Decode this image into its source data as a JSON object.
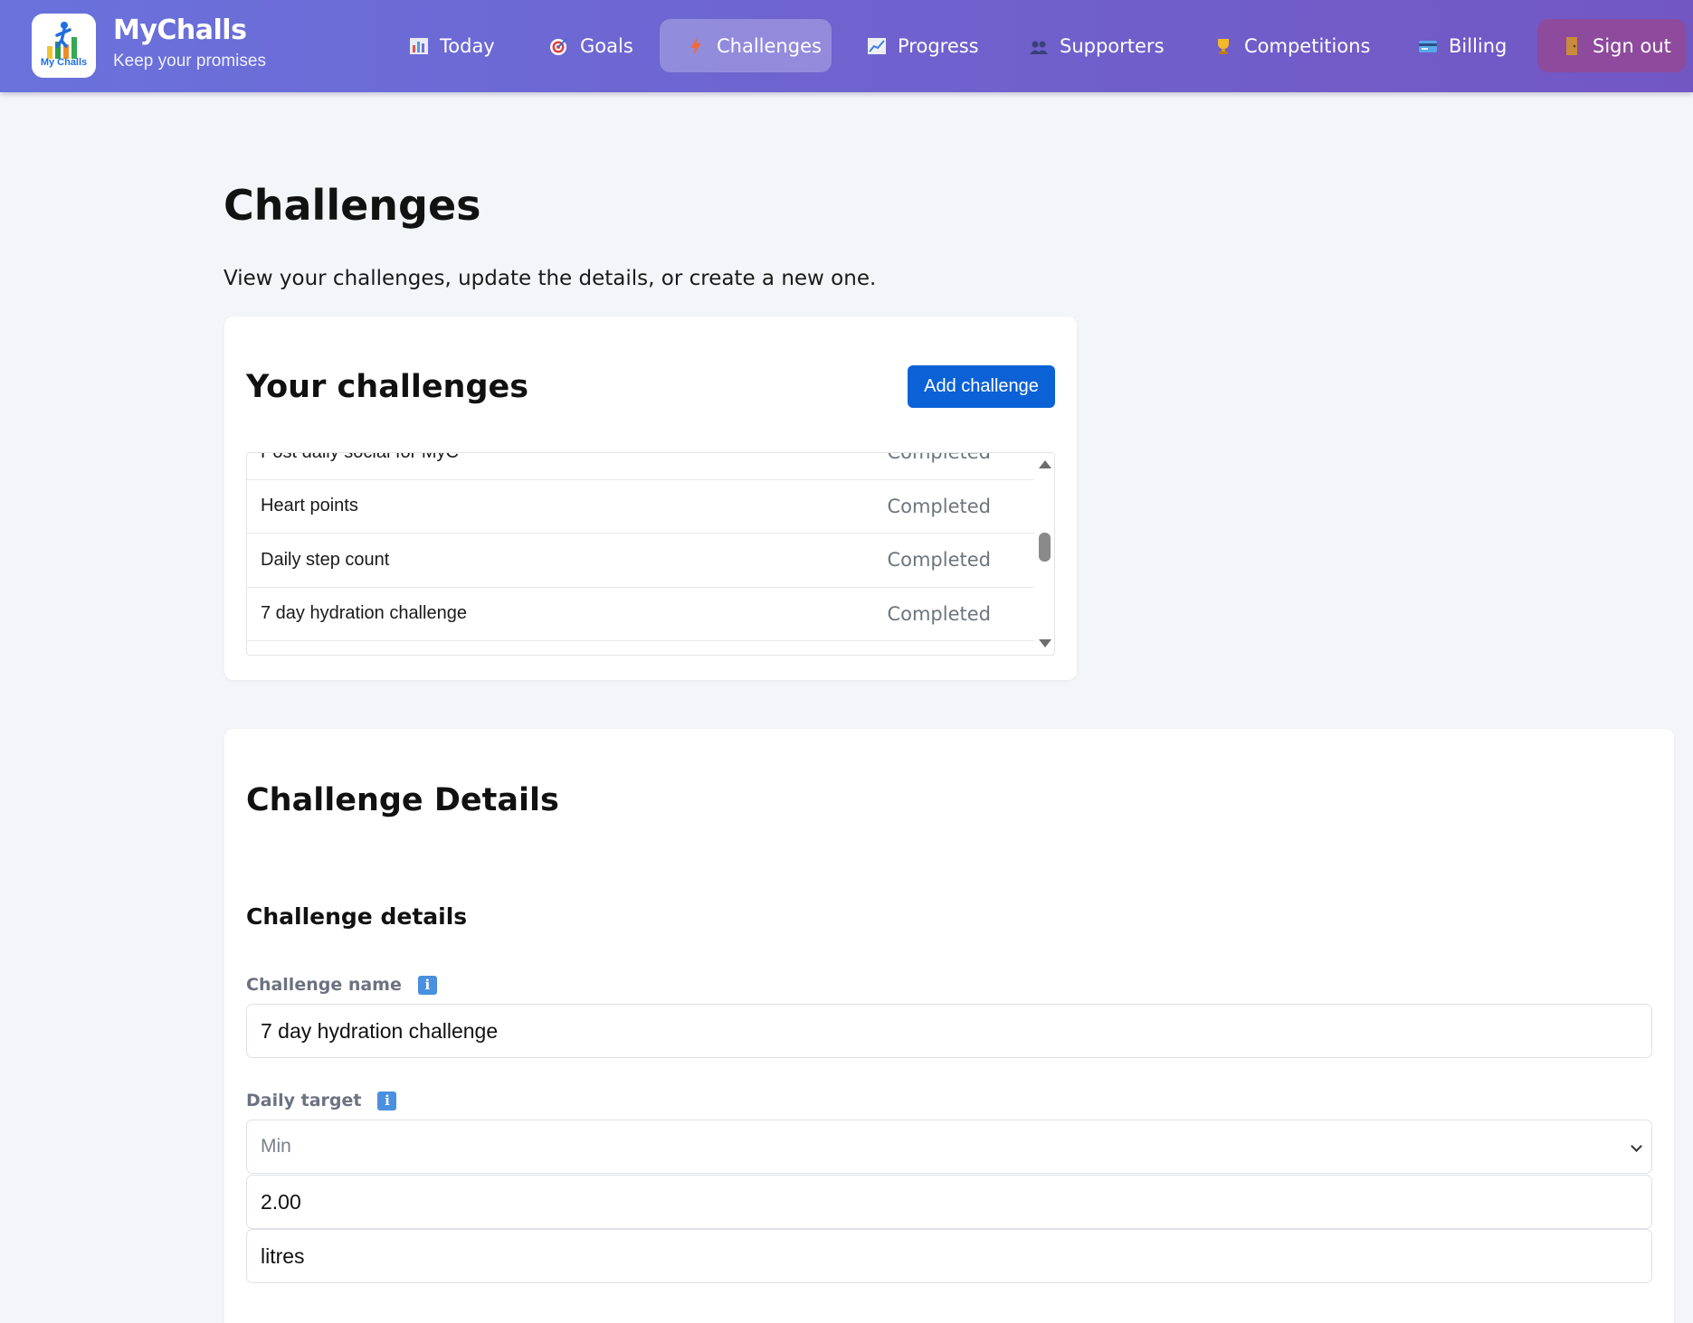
{
  "brand": {
    "name": "MyChalls",
    "tagline": "Keep your promises",
    "logo_text": "My Challs"
  },
  "nav": [
    {
      "label": "Today",
      "icon": "bar-chart-icon"
    },
    {
      "label": "Goals",
      "icon": "target-icon"
    },
    {
      "label": "Challenges",
      "icon": "lightning-icon",
      "active": true
    },
    {
      "label": "Progress",
      "icon": "chart-increasing-icon"
    },
    {
      "label": "Supporters",
      "icon": "people-icon"
    },
    {
      "label": "Competitions",
      "icon": "trophy-icon"
    },
    {
      "label": "Billing",
      "icon": "credit-card-icon"
    },
    {
      "label": "Sign out",
      "icon": "door-icon"
    }
  ],
  "page": {
    "title": "Challenges",
    "subtitle": "View your challenges, update the details, or create a new one."
  },
  "challenges_card": {
    "title": "Your challenges",
    "add_button": "Add challenge",
    "items": [
      {
        "name": "Post daily social for MyC",
        "status": "Completed"
      },
      {
        "name": "Heart points",
        "status": "Completed"
      },
      {
        "name": "Daily step count",
        "status": "Completed"
      },
      {
        "name": "7 day hydration challenge",
        "status": "Completed"
      }
    ]
  },
  "details_card": {
    "title": "Challenge Details",
    "section": "Challenge details",
    "name_label": "Challenge name",
    "name_value": "7 day hydration challenge",
    "target_label": "Daily target",
    "target_mode": "Min",
    "target_amount": "2.00",
    "target_unit": "litres"
  },
  "colors": {
    "header_start": "#6a72dc",
    "header_end": "#7257c3",
    "primary_button": "#0b62d6",
    "signout": "#8e4a9c",
    "status_text": "#6c757d"
  }
}
